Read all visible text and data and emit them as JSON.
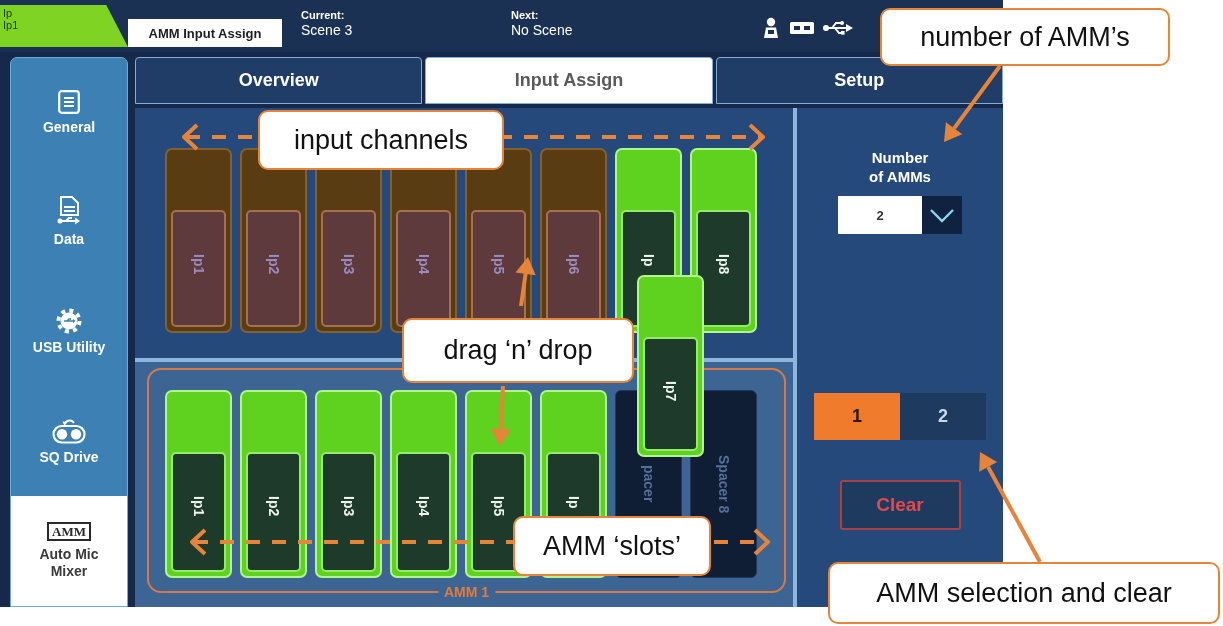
{
  "top_bar": {
    "channel_tag": {
      "type": "Ip",
      "name": "Ip1"
    },
    "screen_title": "AMM Input Assign",
    "current": {
      "label": "Current:",
      "value": "Scene 3"
    },
    "next": {
      "label": "Next:",
      "value": "No Scene"
    }
  },
  "sidebar": {
    "items": [
      {
        "kind": "general",
        "label": "General",
        "selected": false
      },
      {
        "kind": "data",
        "label": "Data",
        "selected": false
      },
      {
        "kind": "usb",
        "label": "USB Utility",
        "selected": false
      },
      {
        "kind": "drive",
        "label": "SQ Drive",
        "selected": false
      },
      {
        "kind": "amm",
        "logo": "AMM",
        "label": "Auto Mic Mixer",
        "selected": true
      }
    ]
  },
  "tabs": [
    {
      "label": "Overview",
      "selected": false
    },
    {
      "label": "Input Assign",
      "selected": true
    },
    {
      "label": "Setup",
      "selected": false
    }
  ],
  "input_channels": [
    {
      "label": "Ip1",
      "assigned": true
    },
    {
      "label": "Ip2",
      "assigned": true
    },
    {
      "label": "Ip3",
      "assigned": true
    },
    {
      "label": "Ip4",
      "assigned": true
    },
    {
      "label": "Ip5",
      "assigned": true
    },
    {
      "label": "Ip6",
      "assigned": true
    },
    {
      "label": "Ip",
      "assigned": false
    },
    {
      "label": "Ip8",
      "assigned": false
    }
  ],
  "dragged_channel": {
    "label": "Ip7"
  },
  "amm_group": {
    "label": "AMM 1",
    "slots": [
      {
        "kind": "channel",
        "label": "Ip1"
      },
      {
        "kind": "channel",
        "label": "Ip2"
      },
      {
        "kind": "channel",
        "label": "Ip3"
      },
      {
        "kind": "channel",
        "label": "Ip4"
      },
      {
        "kind": "channel",
        "label": "Ip5"
      },
      {
        "kind": "channel",
        "label": "Ip"
      },
      {
        "kind": "spacer",
        "label": "pacer"
      },
      {
        "kind": "spacer",
        "label": "Spacer 8"
      }
    ]
  },
  "settings": {
    "number_of_amms": {
      "label": "Number of AMMs",
      "value": "2"
    },
    "amm_selector": [
      {
        "label": "1",
        "selected": true
      },
      {
        "label": "2",
        "selected": false
      }
    ],
    "clear_button": "Clear"
  },
  "annotations": [
    {
      "text": "number of AMM’s"
    },
    {
      "text": "input channels"
    },
    {
      "text": "drag ‘n’ drop"
    },
    {
      "text": "AMM ‘slots’"
    },
    {
      "text": "AMM selection and clear"
    }
  ]
}
